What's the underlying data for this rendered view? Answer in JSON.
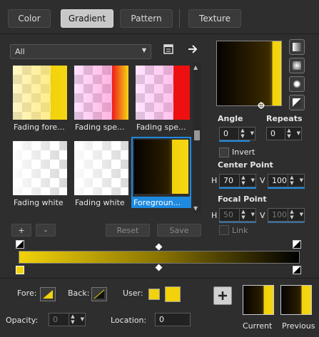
{
  "tabs": [
    {
      "label": "Color"
    },
    {
      "label": "Gradient"
    },
    {
      "label": "Pattern"
    },
    {
      "label": "Texture"
    }
  ],
  "category": {
    "value": "All"
  },
  "swatches": [
    {
      "label": "Fading fore..."
    },
    {
      "label": "Fading spe..."
    },
    {
      "label": "Fading spe..."
    },
    {
      "label": "Fading white"
    },
    {
      "label": "Fading white"
    },
    {
      "label": "Foregroun..."
    }
  ],
  "angle": {
    "label": "Angle",
    "value": "0"
  },
  "repeats": {
    "label": "Repeats",
    "value": "0"
  },
  "invert": {
    "label": "Invert"
  },
  "center_point": {
    "label": "Center Point",
    "h_label": "H",
    "h_value": "70",
    "v_label": "V",
    "v_value": "100"
  },
  "focal_point": {
    "label": "Focal Point",
    "h_label": "H",
    "h_value": "50",
    "v_label": "V",
    "v_value": "100"
  },
  "link": {
    "label": "Link"
  },
  "buttons": {
    "add": "+",
    "remove": "-",
    "reset": "Reset",
    "save": "Save"
  },
  "fore": {
    "label": "Fore:"
  },
  "back": {
    "label": "Back:"
  },
  "user": {
    "label": "User:"
  },
  "opacity": {
    "label": "Opacity:",
    "value": "0"
  },
  "location": {
    "label": "Location:",
    "value": "0"
  },
  "current": {
    "label": "Current"
  },
  "previous": {
    "label": "Previous"
  },
  "colors": {
    "accent": "#1e8ae0",
    "gold": "#f2d20a",
    "panel": "#2e2e2e"
  }
}
